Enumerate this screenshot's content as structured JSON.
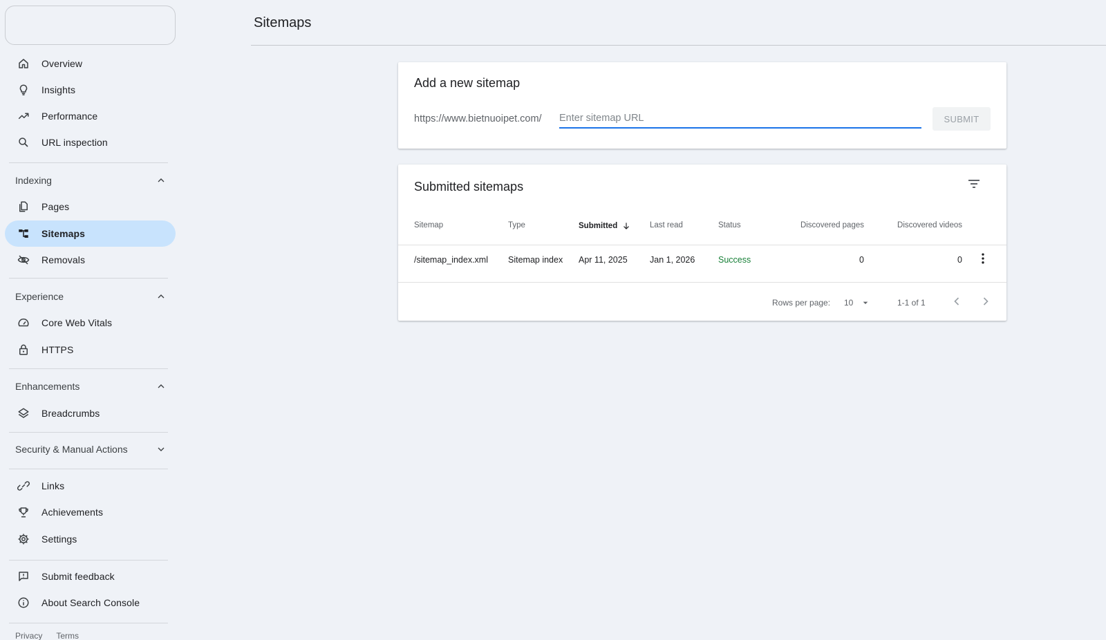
{
  "sidebar": {
    "overview": "Overview",
    "insights": "Insights",
    "performance": "Performance",
    "url_inspection": "URL inspection",
    "indexing": "Indexing",
    "pages": "Pages",
    "sitemaps": "Sitemaps",
    "removals": "Removals",
    "experience": "Experience",
    "core_web_vitals": "Core Web Vitals",
    "https": "HTTPS",
    "enhancements": "Enhancements",
    "breadcrumbs": "Breadcrumbs",
    "security": "Security & Manual Actions",
    "links": "Links",
    "achievements": "Achievements",
    "settings": "Settings",
    "submit_feedback": "Submit feedback",
    "about": "About Search Console",
    "privacy": "Privacy",
    "terms": "Terms"
  },
  "header": {
    "title": "Sitemaps"
  },
  "add_sitemap": {
    "title": "Add a new sitemap",
    "prefix": "https://www.bietnuoipet.com/",
    "placeholder": "Enter sitemap URL",
    "submit_label": "SUBMIT"
  },
  "submitted": {
    "title": "Submitted sitemaps",
    "columns": {
      "sitemap": "Sitemap",
      "type": "Type",
      "submitted": "Submitted",
      "last_read": "Last read",
      "status": "Status",
      "discovered_pages": "Discovered pages",
      "discovered_videos": "Discovered videos"
    },
    "rows": [
      {
        "sitemap": "/sitemap_index.xml",
        "type": "Sitemap index",
        "submitted": "Apr 11, 2025",
        "last_read": "Jan 1, 2026",
        "status": "Success",
        "discovered_pages": "0",
        "discovered_videos": "0"
      }
    ],
    "pagination": {
      "rows_per_page_label": "Rows per page:",
      "rows_per_page": "10",
      "range": "1-1 of 1"
    }
  },
  "colors": {
    "active_nav": "#c8e3fd",
    "accent": "#1a73e8",
    "success": "#188038",
    "background": "#eff2f7"
  }
}
